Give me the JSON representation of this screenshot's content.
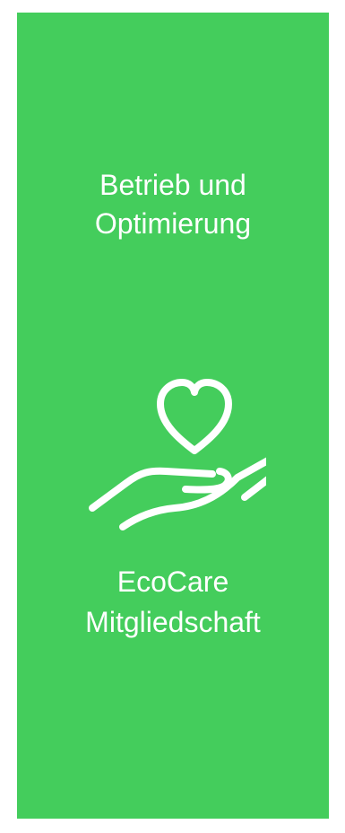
{
  "card": {
    "title": "Betrieb und\nOptimierung",
    "subtitle": "EcoCare\nMitgliedschaft",
    "icon": "heart-in-hand-icon",
    "background_color": "#44cd5c",
    "text_color": "#ffffff"
  }
}
